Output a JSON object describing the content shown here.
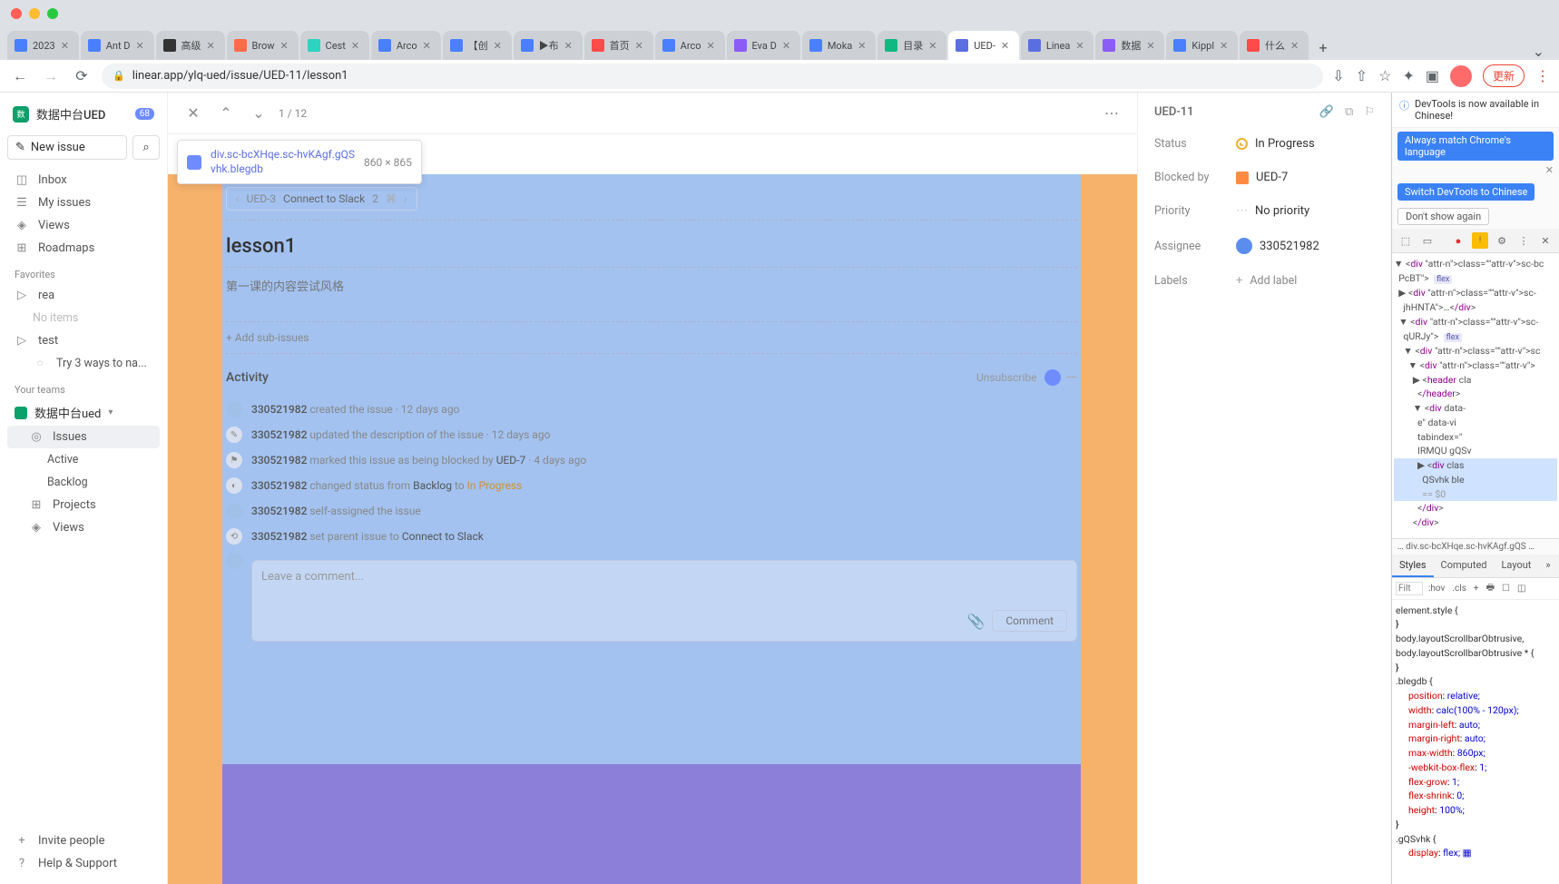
{
  "browser": {
    "url": "linear.app/ylq-ued/issue/UED-11/lesson1",
    "update_label": "更新",
    "tabs": [
      {
        "label": "2023",
        "icon": "#4a7fff"
      },
      {
        "label": "Ant D",
        "icon": "#4a7fff"
      },
      {
        "label": "高级",
        "icon": "#333"
      },
      {
        "label": "Brow",
        "icon": "#ff6b4a"
      },
      {
        "label": "Cest",
        "icon": "#2dd4bf"
      },
      {
        "label": "Arco",
        "icon": "#4a7fff"
      },
      {
        "label": "【创",
        "icon": "#4a7fff"
      },
      {
        "label": "▶布",
        "icon": "#4a7fff"
      },
      {
        "label": "首页",
        "icon": "#ff4a4a"
      },
      {
        "label": "Arco",
        "icon": "#4a7fff"
      },
      {
        "label": "Eva D",
        "icon": "#8b5cf6"
      },
      {
        "label": "Moka",
        "icon": "#4a7fff"
      },
      {
        "label": "目录",
        "icon": "#10b981"
      },
      {
        "label": "UED-",
        "icon": "#5b6ee1",
        "active": true
      },
      {
        "label": "Linea",
        "icon": "#5b6ee1"
      },
      {
        "label": "数据",
        "icon": "#8b5cf6"
      },
      {
        "label": "Kippl",
        "icon": "#4a7fff"
      },
      {
        "label": "什么",
        "icon": "#ff4a4a"
      }
    ]
  },
  "sidebar": {
    "workspace": "数据中台UED",
    "badge": "68",
    "new_issue": "New issue",
    "nav": {
      "inbox": "Inbox",
      "my_issues": "My issues",
      "views": "Views",
      "roadmaps": "Roadmaps"
    },
    "favorites_label": "Favorites",
    "favorites": [
      {
        "name": "rea"
      },
      {
        "name": "No items",
        "empty": true
      },
      {
        "name": "test"
      },
      {
        "name": "Try 3 ways to na...",
        "sub": true
      }
    ],
    "teams_label": "Your teams",
    "team_name": "数据中台ued",
    "team_items": {
      "issues": "Issues",
      "active": "Active",
      "backlog": "Backlog",
      "projects": "Projects",
      "views": "Views"
    },
    "invite": "Invite people",
    "help": "Help & Support"
  },
  "header": {
    "counter": "1 / 12"
  },
  "inspect": {
    "selector_l1": "div.sc-bcXHqe.sc-hvKAgf.gQS",
    "selector_l2": "vhk.blegdb",
    "dims": "860 × 865"
  },
  "issue": {
    "parent_id": "UED-3",
    "parent_title": "Connect to Slack",
    "parent_count": "2",
    "title": "lesson1",
    "description": "第一课的内容尝试风格",
    "add_sub": "+ Add sub-issues"
  },
  "activity": {
    "header": "Activity",
    "unsubscribe": "Unsubscribe",
    "items": [
      {
        "user": "330521982",
        "text": "created the issue",
        "ago": "12 days ago",
        "icon": "avatar"
      },
      {
        "user": "330521982",
        "text": "updated the description of the issue",
        "ago": "12 days ago",
        "icon": "pencil"
      },
      {
        "user": "330521982",
        "text": "marked this issue as being blocked by",
        "link": "UED-7",
        "ago": "4 days ago",
        "icon": "flag"
      },
      {
        "user": "330521982",
        "text": "changed status from",
        "from": "Backlog",
        "mid": "to",
        "to": "In Progress",
        "icon": "status"
      },
      {
        "user": "330521982",
        "text": "self-assigned the issue",
        "icon": "avatar"
      },
      {
        "user": "330521982",
        "text": "set parent issue to",
        "link": "Connect to Slack",
        "icon": "link"
      }
    ],
    "comment_placeholder": "Leave a comment...",
    "comment_btn": "Comment"
  },
  "props": {
    "id": "UED-11",
    "status": {
      "label": "Status",
      "value": "In Progress"
    },
    "blocked": {
      "label": "Blocked by",
      "value": "UED-7"
    },
    "priority": {
      "label": "Priority",
      "value": "No priority"
    },
    "assignee": {
      "label": "Assignee",
      "value": "330521982"
    },
    "labels": {
      "label": "Labels",
      "value": "Add label"
    }
  },
  "devtools": {
    "notice": "DevTools is now available in Chinese!",
    "btn1": "Always match Chrome's language",
    "btn2": "Switch DevTools to Chinese",
    "dontshow": "Don't show again",
    "crumb": "div.sc-bcXHqe.sc-hvKAgf.gQS",
    "tabs": {
      "styles": "Styles",
      "computed": "Computed",
      "layout": "Layout"
    },
    "filter": "Filt",
    "hov": ":hov",
    "cls": ".cls",
    "dom": [
      {
        "indent": 0,
        "text": "<div class=\"sc-bc",
        "triangle": "▼"
      },
      {
        "indent": 0,
        "text": "PcBT\"> ",
        "flex": "flex"
      },
      {
        "indent": 1,
        "text": "<div class=\"sc-",
        "triangle": "▶"
      },
      {
        "indent": 1,
        "text": "jhHNTA\">…</div>"
      },
      {
        "indent": 1,
        "text": "<div class=\"sc-",
        "triangle": "▼"
      },
      {
        "indent": 1,
        "text": "qURJy\"> ",
        "flex": "flex"
      },
      {
        "indent": 2,
        "text": "<div class=\"sc",
        "triangle": "▼"
      },
      {
        "indent": 3,
        "text": "<div class=\"",
        "triangle": "▼"
      },
      {
        "indent": 4,
        "text": "<header cla",
        "triangle": "▶"
      },
      {
        "indent": 4,
        "text": "</header>"
      },
      {
        "indent": 4,
        "text": "<div data-",
        "triangle": "▼"
      },
      {
        "indent": 4,
        "text": "e\" data-vi"
      },
      {
        "indent": 4,
        "text": "tabindex=\""
      },
      {
        "indent": 4,
        "text": "IRMQU gQSv"
      },
      {
        "indent": 5,
        "text": "<div clas",
        "triangle": "▶",
        "hl": true
      },
      {
        "indent": 5,
        "text": "QSvhk ble",
        "hl": true
      },
      {
        "indent": 5,
        "text": "== $0",
        "dim": true,
        "hl": true
      },
      {
        "indent": 4,
        "text": "</div>"
      },
      {
        "indent": 3,
        "text": "</div>"
      }
    ],
    "styles": [
      {
        "sel": "element.style {",
        "src": ""
      },
      {
        "close": "}"
      },
      {
        "sel": "body.layoutScrollbarObtrusive,",
        "src": "<style>"
      },
      {
        "sel": "body.layoutScrollbarObtrusive * {"
      },
      {
        "close": "}"
      },
      {
        "sel": ".blegdb {",
        "src": "<style>"
      },
      {
        "prop": "position",
        "val": "relative;"
      },
      {
        "prop": "width",
        "val": "calc(100% - 120px);"
      },
      {
        "prop": "margin-left",
        "val": "auto;"
      },
      {
        "prop": "margin-right",
        "val": "auto;"
      },
      {
        "prop": "max-width",
        "val": "860px;"
      },
      {
        "prop": "-webkit-box-flex",
        "val": "1;"
      },
      {
        "prop": "flex-grow",
        "val": "1;"
      },
      {
        "prop": "flex-shrink",
        "val": "0;"
      },
      {
        "prop": "height",
        "val": "100%;"
      },
      {
        "close": "}"
      },
      {
        "sel": ".gQSvhk {",
        "src": "<style>"
      },
      {
        "prop": "display",
        "val": "flex; ▦"
      }
    ]
  }
}
